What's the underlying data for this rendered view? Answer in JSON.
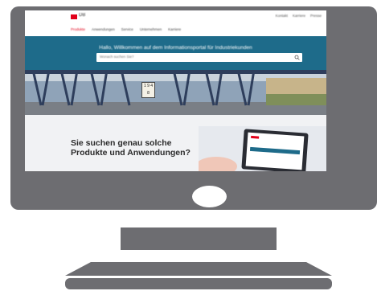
{
  "site": {
    "logo_text": "DB",
    "util_nav": [
      "Kontakt",
      "Karriere",
      "Presse"
    ],
    "main_nav": [
      "Produkte",
      "Anwendungen",
      "Service",
      "Unternehmen",
      "Karriere"
    ],
    "hero_title": "Hallo, Willkommen auf dem Informationsportal für Industriekunden",
    "search_placeholder": "Wonach suchen Sie?",
    "sign_text": "1 9 4\n8",
    "promo_title": "Sie suchen genau solche Produkte und Anwendungen?"
  },
  "colors": {
    "frame": "#6d6d71",
    "brand_red": "#e2001a",
    "hero_teal": "#1e6b8a"
  }
}
